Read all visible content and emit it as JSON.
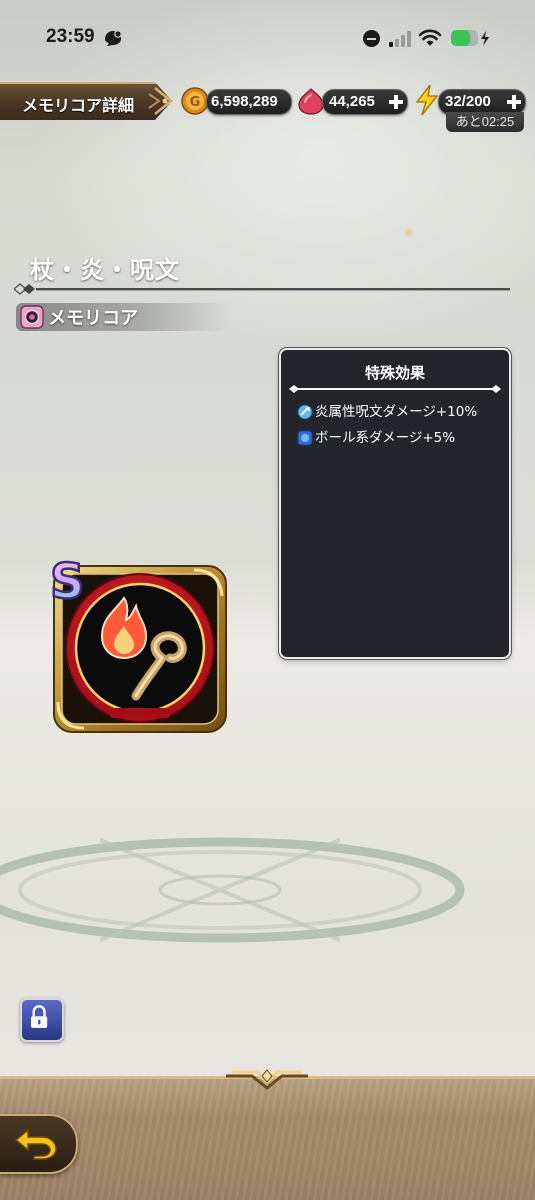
{
  "status_bar": {
    "time": "23:59",
    "battery_level": 0.72
  },
  "header": {
    "title": "メモリコア詳細",
    "gold": "6,598,289",
    "gems": "44,265",
    "stamina": "32/200",
    "stamina_timer": "あと02:25"
  },
  "item": {
    "name": "杖・炎・呪文",
    "category": "メモリコア",
    "rank": "S"
  },
  "effects": {
    "title": "特殊効果",
    "rows": [
      {
        "icon": "spell-icon",
        "label": "炎属性呪文ダメージ+10%"
      },
      {
        "icon": "blue-orb-icon",
        "label": "ボール系ダメージ+5%"
      }
    ]
  },
  "colors": {
    "medallion_ring": "#d0101a",
    "gold_frame": "#c9a34a",
    "panel_bg": "#24252b",
    "bottom_bar": "#a58d6d"
  }
}
